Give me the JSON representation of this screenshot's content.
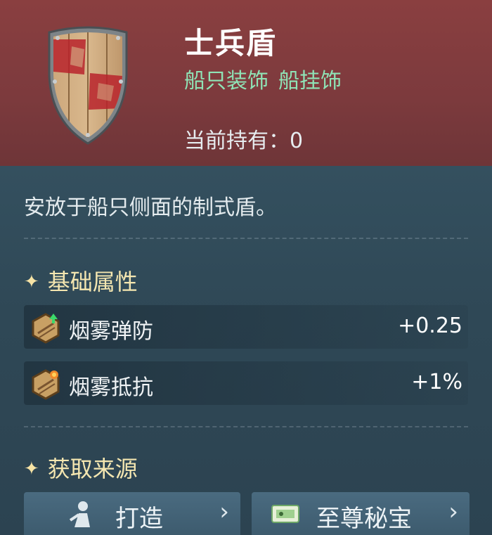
{
  "item": {
    "title": "士兵盾",
    "tags": [
      "船只装饰",
      "船挂饰"
    ],
    "owned_label": "当前持有：",
    "owned_count": "0",
    "description": "安放于船只侧面的制式盾。"
  },
  "sections": {
    "basic_title": "基础属性",
    "source_title": "获取来源"
  },
  "attributes": [
    {
      "name": "烟雾弹防",
      "value": "+0.25",
      "icon": "smoke-defense-icon"
    },
    {
      "name": "烟雾抵抗",
      "value": "+1%",
      "icon": "smoke-resist-icon"
    }
  ],
  "sources": [
    {
      "label": "打造",
      "icon": "craft-figure-icon"
    },
    {
      "label": "至尊秘宝",
      "icon": "ticket-icon"
    }
  ],
  "colors": {
    "header": "#7c3a3d",
    "panel": "#2f4856",
    "tag_green": "#8fe3b6",
    "section_gold": "#f4e6b0",
    "button": "#456577"
  }
}
